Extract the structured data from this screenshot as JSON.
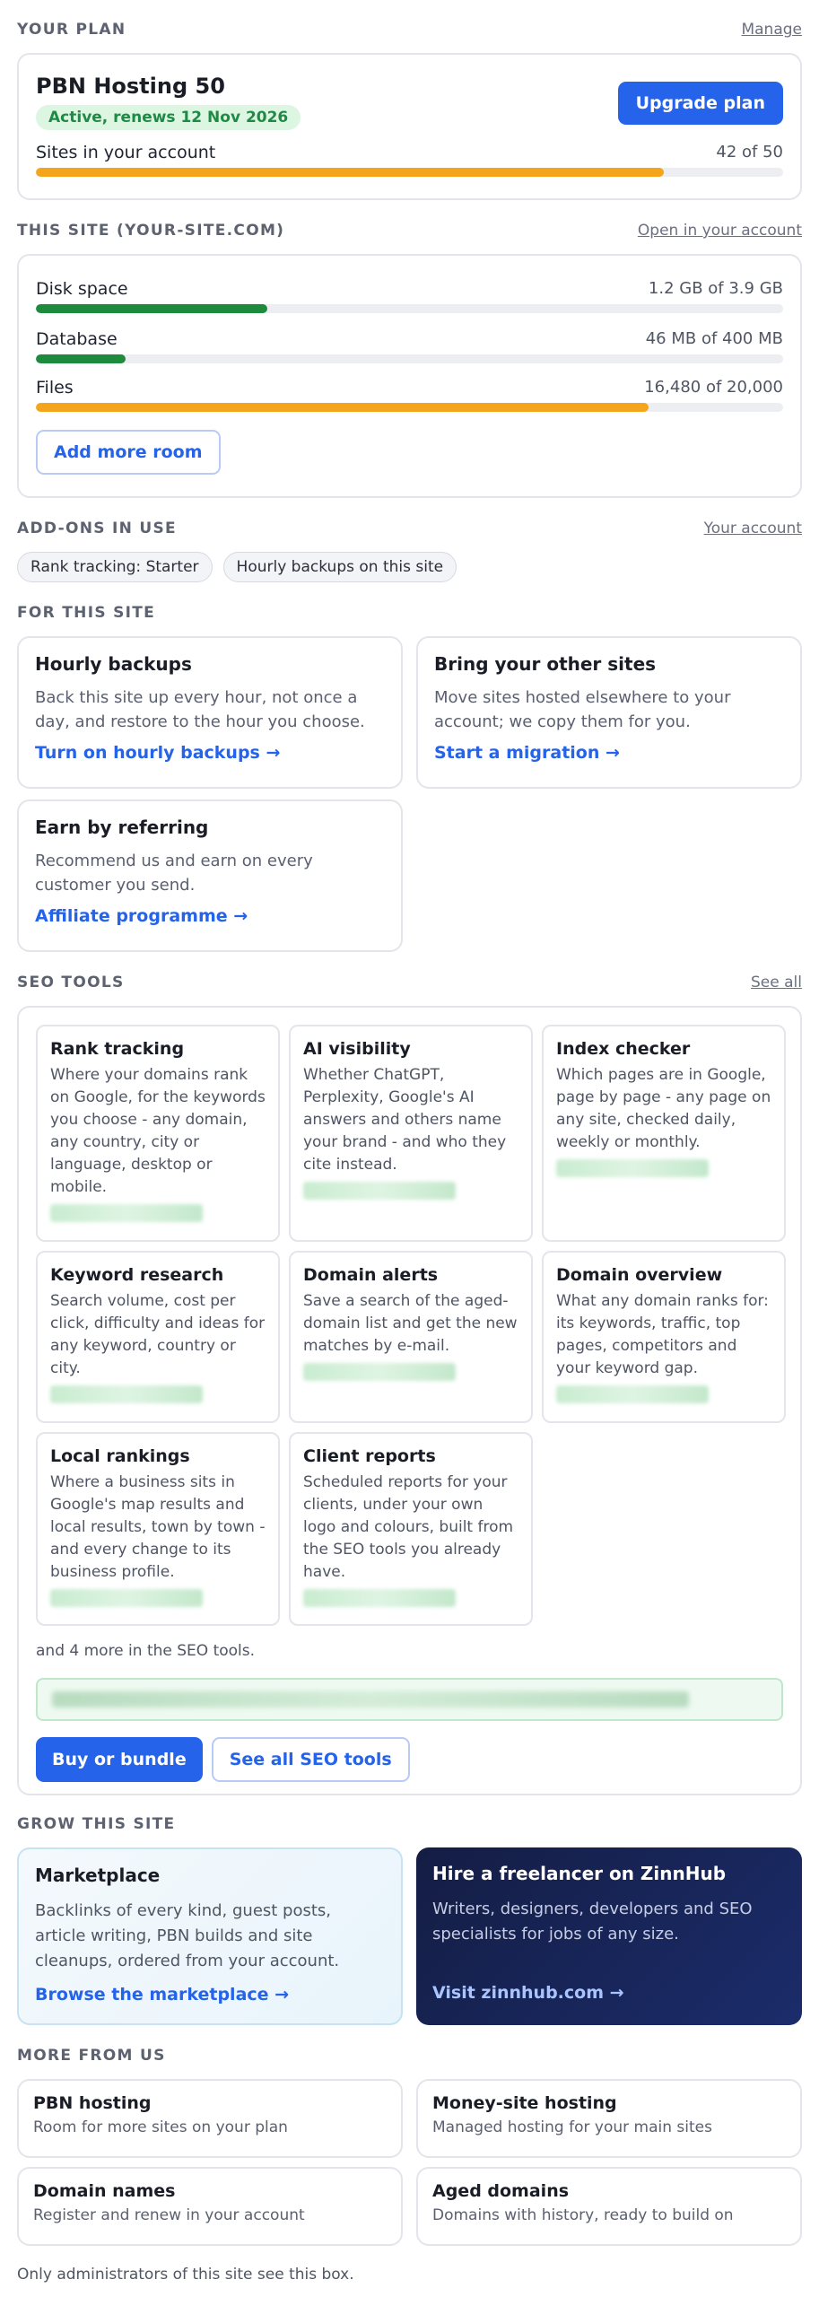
{
  "plan": {
    "section_title": "YOUR PLAN",
    "manage_label": "Manage",
    "name": "PBN Hosting 50",
    "status": "Active, renews 12 Nov 2026",
    "upgrade_label": "Upgrade plan",
    "sites_label": "Sites in your account",
    "sites_value": "42 of 50",
    "sites_fraction": 0.84,
    "bar_color": "#f4a51c"
  },
  "site": {
    "section_title": "THIS SITE (YOUR-SITE.COM)",
    "open_label": "Open in your account",
    "rows": [
      {
        "label": "Disk space",
        "value": "1.2 GB of 3.9 GB",
        "fraction": 0.31,
        "color": "#1e8a3e"
      },
      {
        "label": "Database",
        "value": "46 MB of 400 MB",
        "fraction": 0.12,
        "color": "#1e8a3e"
      },
      {
        "label": "Files",
        "value": "16,480 of 20,000",
        "fraction": 0.82,
        "color": "#f4a51c"
      }
    ],
    "add_room_label": "Add more room"
  },
  "addons": {
    "section_title": "ADD-ONS IN USE",
    "account_label": "Your account",
    "chips": [
      "Rank tracking: Starter",
      "Hourly backups on this site"
    ]
  },
  "for_site": {
    "section_title": "FOR THIS SITE",
    "tiles": [
      {
        "title": "Hourly backups",
        "text": "Back this site up every hour, not once a day, and restore to the hour you choose.",
        "link": "Turn on hourly backups →"
      },
      {
        "title": "Bring your other sites",
        "text": "Move sites hosted elsewhere to your account; we copy them for you.",
        "link": "Start a migration →"
      },
      {
        "title": "Earn by referring",
        "text": "Recommend us and earn on every customer you send.",
        "link": "Affiliate programme →"
      }
    ]
  },
  "seo": {
    "section_title": "SEO TOOLS",
    "see_all_label": "See all",
    "tools": [
      {
        "title": "Rank tracking",
        "text": "Where your domains rank on Google, for the keywords you choose - any domain, any country, city or language, desktop or mobile."
      },
      {
        "title": "AI visibility",
        "text": "Whether ChatGPT, Perplexity, Google's AI answers and others name your brand - and who they cite instead."
      },
      {
        "title": "Index checker",
        "text": "Which pages are in Google, page by page - any page on any site, checked daily, weekly or monthly."
      },
      {
        "title": "Keyword research",
        "text": "Search volume, cost per click, difficulty and ideas for any keyword, country or city."
      },
      {
        "title": "Domain alerts",
        "text": "Save a search of the aged-domain list and get the new matches by e-mail."
      },
      {
        "title": "Domain overview",
        "text": "What any domain ranks for: its keywords, traffic, top pages, competitors and your keyword gap."
      },
      {
        "title": "Local rankings",
        "text": "Where a business sits in Google's map results and local results, town by town - and every change to its business profile."
      },
      {
        "title": "Client reports",
        "text": "Scheduled reports for your clients, under your own logo and colours, built from the SEO tools you already have."
      }
    ],
    "more_text": "and 4 more in the SEO tools.",
    "buy_label": "Buy or bundle",
    "see_tools_label": "See all SEO tools"
  },
  "grow": {
    "section_title": "GROW THIS SITE",
    "marketplace": {
      "title": "Marketplace",
      "text": "Backlinks of every kind, guest posts, article writing, PBN builds and site cleanups, ordered from your account.",
      "link": "Browse the marketplace →"
    },
    "hire": {
      "title": "Hire a freelancer on ZinnHub",
      "text": "Writers, designers, developers and SEO specialists for jobs of any size.",
      "link": "Visit zinnhub.com →"
    }
  },
  "more": {
    "section_title": "MORE FROM US",
    "items": [
      {
        "title": "PBN hosting",
        "text": "Room for more sites on your plan"
      },
      {
        "title": "Money-site hosting",
        "text": "Managed hosting for your main sites"
      },
      {
        "title": "Domain names",
        "text": "Register and renew in your account"
      },
      {
        "title": "Aged domains",
        "text": "Domains with history, ready to build on"
      }
    ]
  },
  "footer": "Only administrators of this site see this box."
}
